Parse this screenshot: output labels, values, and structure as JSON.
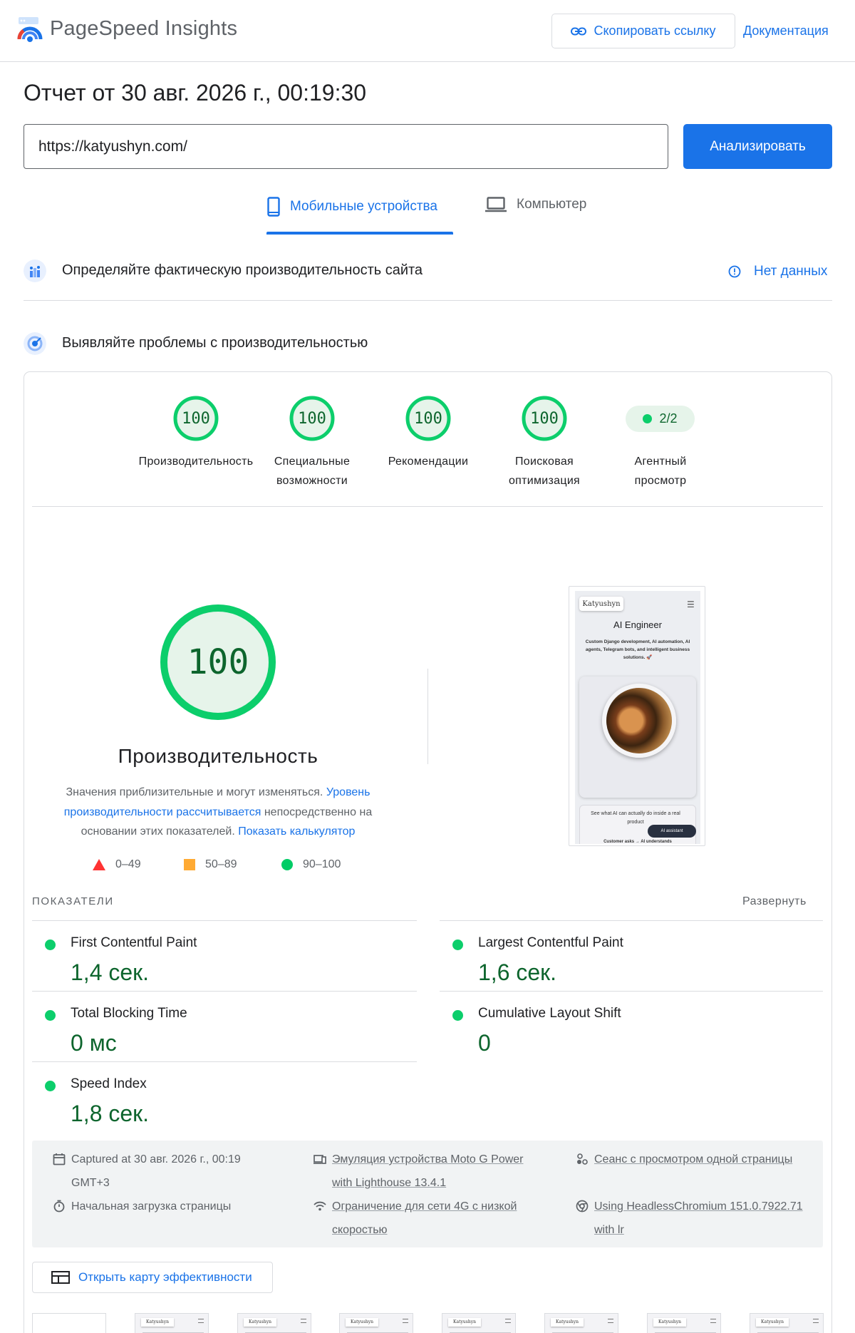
{
  "header": {
    "app_name": "PageSpeed Insights",
    "copy_link_label": "Скопировать ссылку",
    "docs_label": "Документация"
  },
  "report": {
    "title": "Отчет от 30 авг. 2026 г., 00:19:30",
    "url_value": "https://katyushyn.com/",
    "analyze_label": "Анализировать"
  },
  "tabs": {
    "mobile": "Мобильные устройства",
    "desktop": "Компьютер",
    "active": "mobile"
  },
  "field_data": {
    "title": "Определяйте фактическую производительность сайта",
    "status": "Нет данных"
  },
  "lab": {
    "title": "Выявляйте проблемы с производительностью",
    "categories": [
      {
        "score": "100",
        "label": "Производительность"
      },
      {
        "score": "100",
        "label": "Специальные возможности"
      },
      {
        "score": "100",
        "label": "Рекомендации"
      },
      {
        "score": "100",
        "label": "Поисковая оптимизация"
      }
    ],
    "agent": {
      "value": "2/2",
      "label": "Агентный просмотр"
    }
  },
  "performance": {
    "score": "100",
    "title": "Производительность",
    "desc_1": "Значения приблизительные и могут изменяться. ",
    "desc_link_1": "Уровень производительности рассчитывается",
    "desc_2": " непосредственно на основании этих показателей. ",
    "desc_link_2": "Показать калькулятор",
    "legend": [
      {
        "range": "0–49",
        "color": "#f33"
      },
      {
        "range": "50–89",
        "color": "#fa3"
      },
      {
        "range": "90–100",
        "color": "#0c6"
      }
    ]
  },
  "screenshot": {
    "brand": "Katyushyn",
    "heading": "AI Engineer",
    "text": "Custom Django development, AI automation, AI agents, Telegram bots, and intelligent business solutions. 🚀",
    "cta": "See what AI can actually do inside a real product",
    "ai_button": "AI assistant",
    "bottom": "Customer asks → AI understands"
  },
  "metrics": {
    "title": "ПОКАЗАТЕЛИ",
    "expand": "Развернуть",
    "items": [
      {
        "name": "First Contentful Paint",
        "value": "1,4 сек."
      },
      {
        "name": "Largest Contentful Paint",
        "value": "1,6 сек."
      },
      {
        "name": "Total Blocking Time",
        "value": "0 мс"
      },
      {
        "name": "Cumulative Layout Shift",
        "value": "0"
      },
      {
        "name": "Speed Index",
        "value": "1,8 сек."
      }
    ]
  },
  "info": {
    "captured_1": "Captured at 30 авг. 2026 г., 00:19",
    "captured_2": "GMT+3",
    "initial_load": "Начальная загрузка страницы",
    "emulation_1": "Эмуляция устройства Moto G Power",
    "emulation_2": "with Lighthouse 13.4.1",
    "throttle_1": "Ограничение для сети 4G с низкой",
    "throttle_2": "скоростью",
    "session": "Сеанс с просмотром одной страницы",
    "browser_1": "Using HeadlessChromium 151.0.7922.71",
    "browser_2": "with lr"
  },
  "treemap_label": "Открыть карту эффективности",
  "colors": {
    "accent": "#1a73e8",
    "pass": "#0cce6b",
    "pass_text": "#0d652d"
  }
}
